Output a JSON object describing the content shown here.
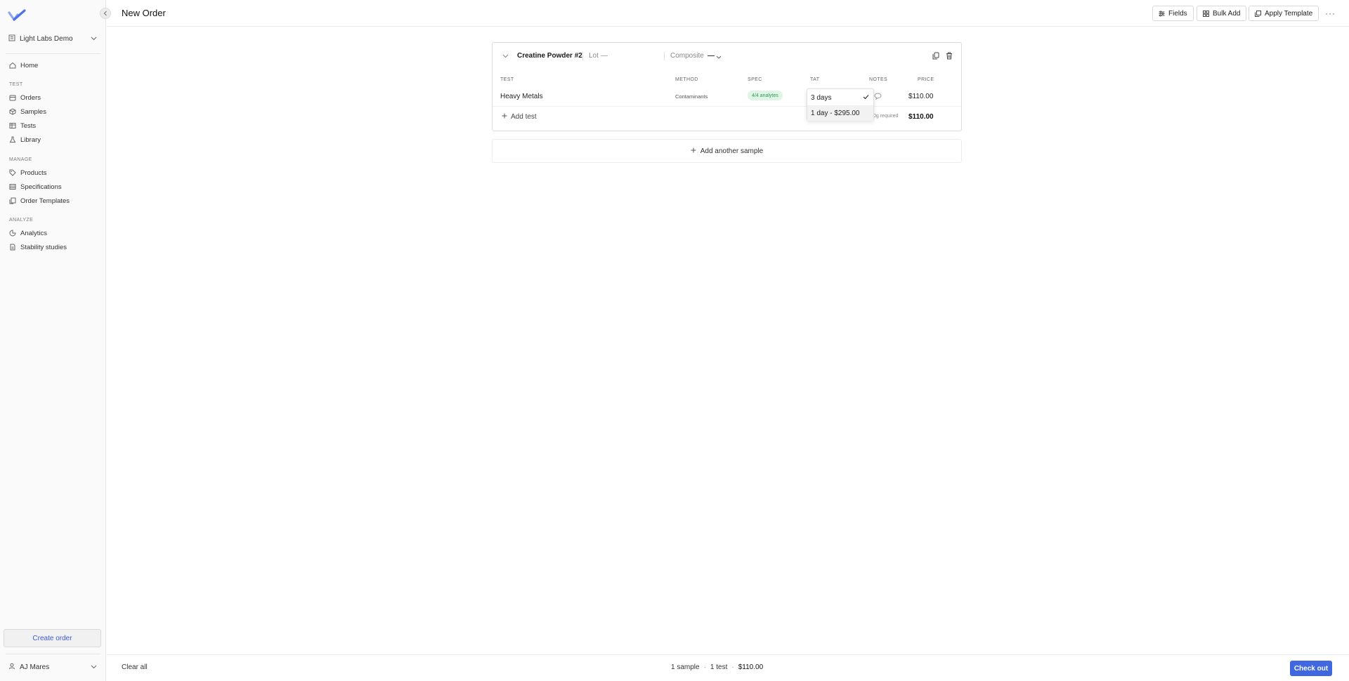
{
  "app": {
    "accent_color": "#3f67e0",
    "brand_color": "#6b8ff0"
  },
  "sidebar": {
    "workspace": "Light Labs Demo",
    "home": "Home",
    "sections": {
      "test": "TEST",
      "manage": "MANAGE",
      "analyze": "ANALYZE"
    },
    "test_items": [
      "Orders",
      "Samples",
      "Tests",
      "Library"
    ],
    "manage_items": [
      "Products",
      "Specifications",
      "Order Templates"
    ],
    "analyze_items": [
      "Analytics",
      "Stability studies"
    ],
    "create_order": "Create order",
    "user": "AJ Mares"
  },
  "header": {
    "title": "New Order",
    "fields_label": "Fields",
    "bulk_add_label": "Bulk Add",
    "apply_template_label": "Apply Template",
    "more_label": "···"
  },
  "sample": {
    "name": "Creatine Powder #2",
    "lot_label": "Lot",
    "lot_value": "—",
    "composite_label": "Composite",
    "composite_value": "—",
    "columns": {
      "test": "TEST",
      "method": "METHOD",
      "spec": "SPEC",
      "tat": "TAT",
      "notes": "NOTES",
      "price": "PRICE"
    },
    "tests": [
      {
        "name": "Heavy Metals",
        "method": "Contaminants",
        "spec": "4/4 analytes",
        "price": "$110.00"
      }
    ],
    "add_test_label": "Add test",
    "requirement_text": "0g required",
    "total": "$110.00"
  },
  "tat_dropdown": {
    "options": [
      {
        "label": "3 days",
        "selected": true
      },
      {
        "label": "1 day - $295.00",
        "selected": false
      }
    ]
  },
  "add_another_sample": "Add another sample",
  "footer": {
    "clear_all": "Clear all",
    "samples": "1 sample",
    "tests": "1 test",
    "total": "$110.00",
    "checkout": "Check out"
  }
}
